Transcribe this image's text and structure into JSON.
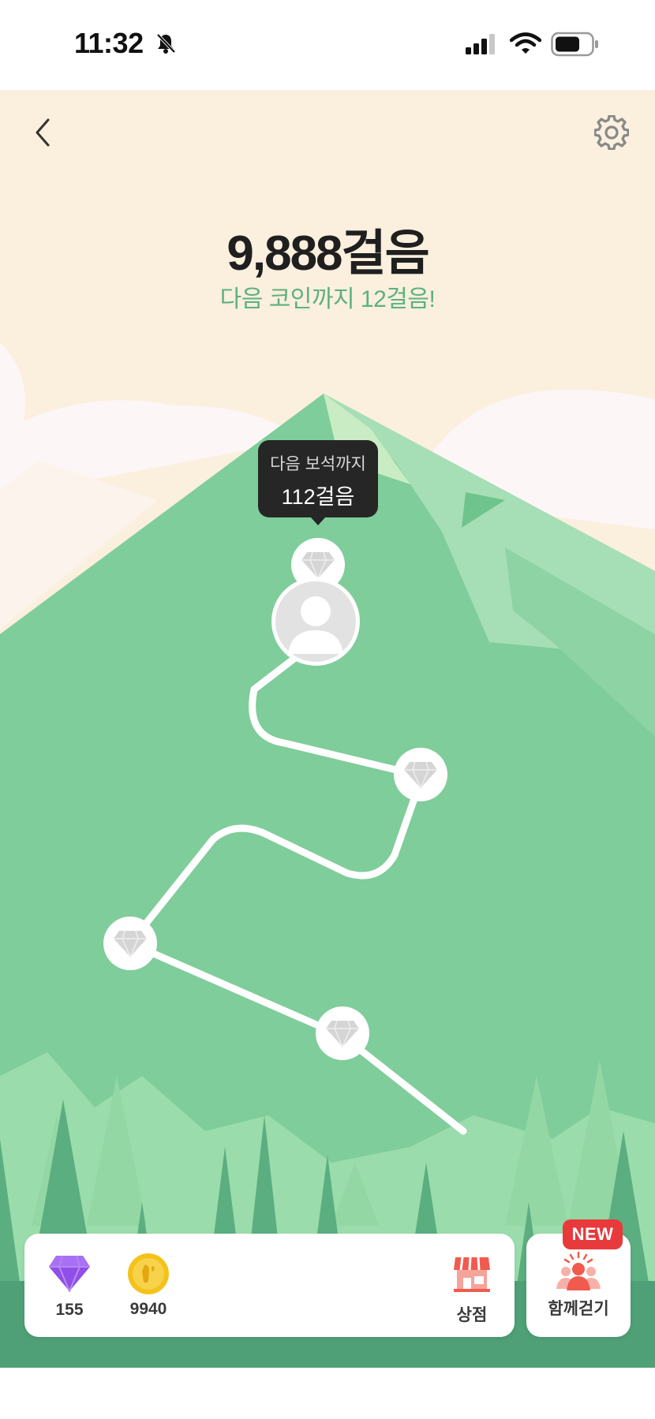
{
  "status_bar": {
    "time": "11:32"
  },
  "header": {
    "steps_total": "9,888걸음",
    "next_coin": "다음 코인까지 12걸음!"
  },
  "tooltip": {
    "line1": "다음 보석까지",
    "line2": "112걸음"
  },
  "icons": [
    "back-arrow-icon",
    "gear-icon",
    "diamond-icon",
    "coin-icon",
    "shop-icon",
    "people-icon",
    "avatar-icon"
  ],
  "colors": {
    "sky": "#fbefde",
    "mountain": "#7fcd9a",
    "accent_text": "#5cb27b",
    "badge": "#e8393b"
  },
  "wallet": {
    "gems": "155",
    "coins": "9940"
  },
  "nav": {
    "shop_label": "상점",
    "walk_together_label": "함께걷기",
    "new_badge": "NEW"
  }
}
